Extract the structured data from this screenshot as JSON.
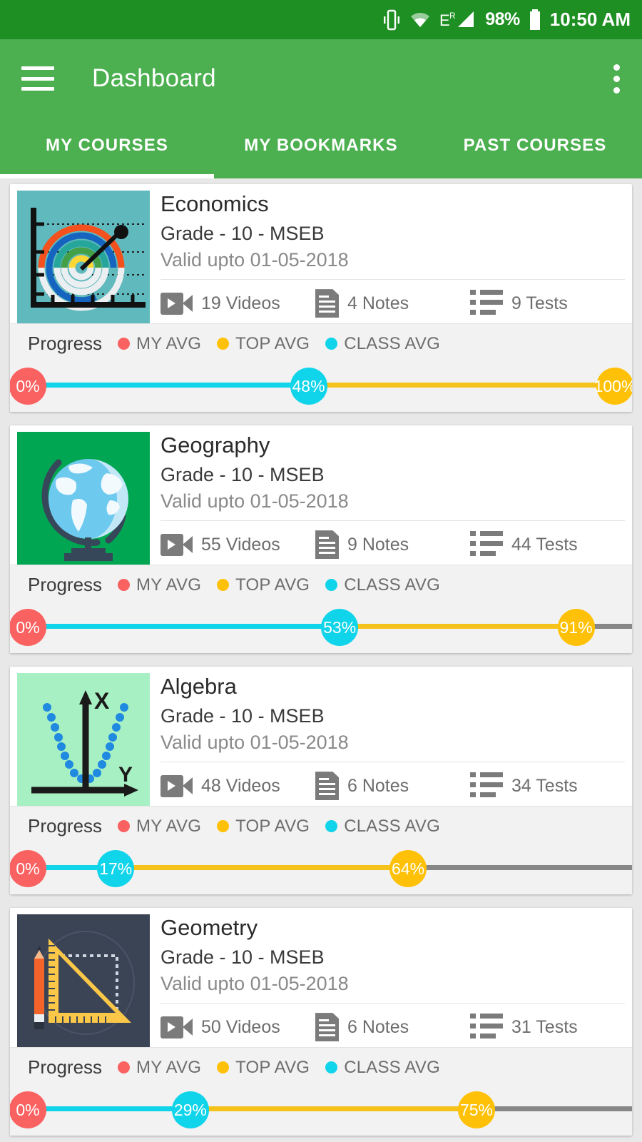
{
  "status_bar": {
    "battery_percent": "98%",
    "time": "10:50 AM",
    "icons": [
      "vibrate-icon",
      "wifi-icon",
      "edge-signal-icon",
      "battery-icon"
    ]
  },
  "app_bar": {
    "title": "Dashboard",
    "menu_icon": "hamburger-icon",
    "overflow_icon": "kebab-menu-icon",
    "accent_color": "#4caf50",
    "status_color": "#1e9023"
  },
  "tabs": [
    {
      "label": "MY COURSES",
      "active": true
    },
    {
      "label": "MY BOOKMARKS",
      "active": false
    },
    {
      "label": "PAST COURSES",
      "active": false
    }
  ],
  "legend": {
    "title": "Progress",
    "items": [
      {
        "label": "MY AVG",
        "color": "#fa6161"
      },
      {
        "label": "TOP AVG",
        "color": "#ffc107"
      },
      {
        "label": "CLASS AVG",
        "color": "#0fd4ea"
      }
    ]
  },
  "colors": {
    "my_avg": "#fa6161",
    "top_avg": "#ffc107",
    "class_avg": "#0fd4ea",
    "track": "#878787"
  },
  "courses": [
    {
      "title": "Economics",
      "grade": "Grade - 10 - MSEB",
      "valid": "Valid upto 01-05-2018",
      "videos": "19 Videos",
      "notes": "4 Notes",
      "tests": "9 Tests",
      "thumb": "economics-chart-thumbnail",
      "progress": {
        "my_avg": "0%",
        "class_avg": "48%",
        "top_avg": "100%"
      }
    },
    {
      "title": "Geography",
      "grade": "Grade - 10 - MSEB",
      "valid": "Valid upto 01-05-2018",
      "videos": "55 Videos",
      "notes": "9 Notes",
      "tests": "44 Tests",
      "thumb": "geography-globe-thumbnail",
      "progress": {
        "my_avg": "0%",
        "class_avg": "53%",
        "top_avg": "91%"
      }
    },
    {
      "title": "Algebra",
      "grade": "Grade - 10 - MSEB",
      "valid": "Valid upto 01-05-2018",
      "videos": "48 Videos",
      "notes": "6 Notes",
      "tests": "34 Tests",
      "thumb": "algebra-parabola-thumbnail",
      "progress": {
        "my_avg": "0%",
        "class_avg": "17%",
        "top_avg": "64%"
      }
    },
    {
      "title": "Geometry",
      "grade": "Grade - 10 - MSEB",
      "valid": "Valid upto 01-05-2018",
      "videos": "50 Videos",
      "notes": "6 Notes",
      "tests": "31 Tests",
      "thumb": "geometry-ruler-thumbnail",
      "progress": {
        "my_avg": "0%",
        "class_avg": "29%",
        "top_avg": "75%"
      }
    }
  ]
}
